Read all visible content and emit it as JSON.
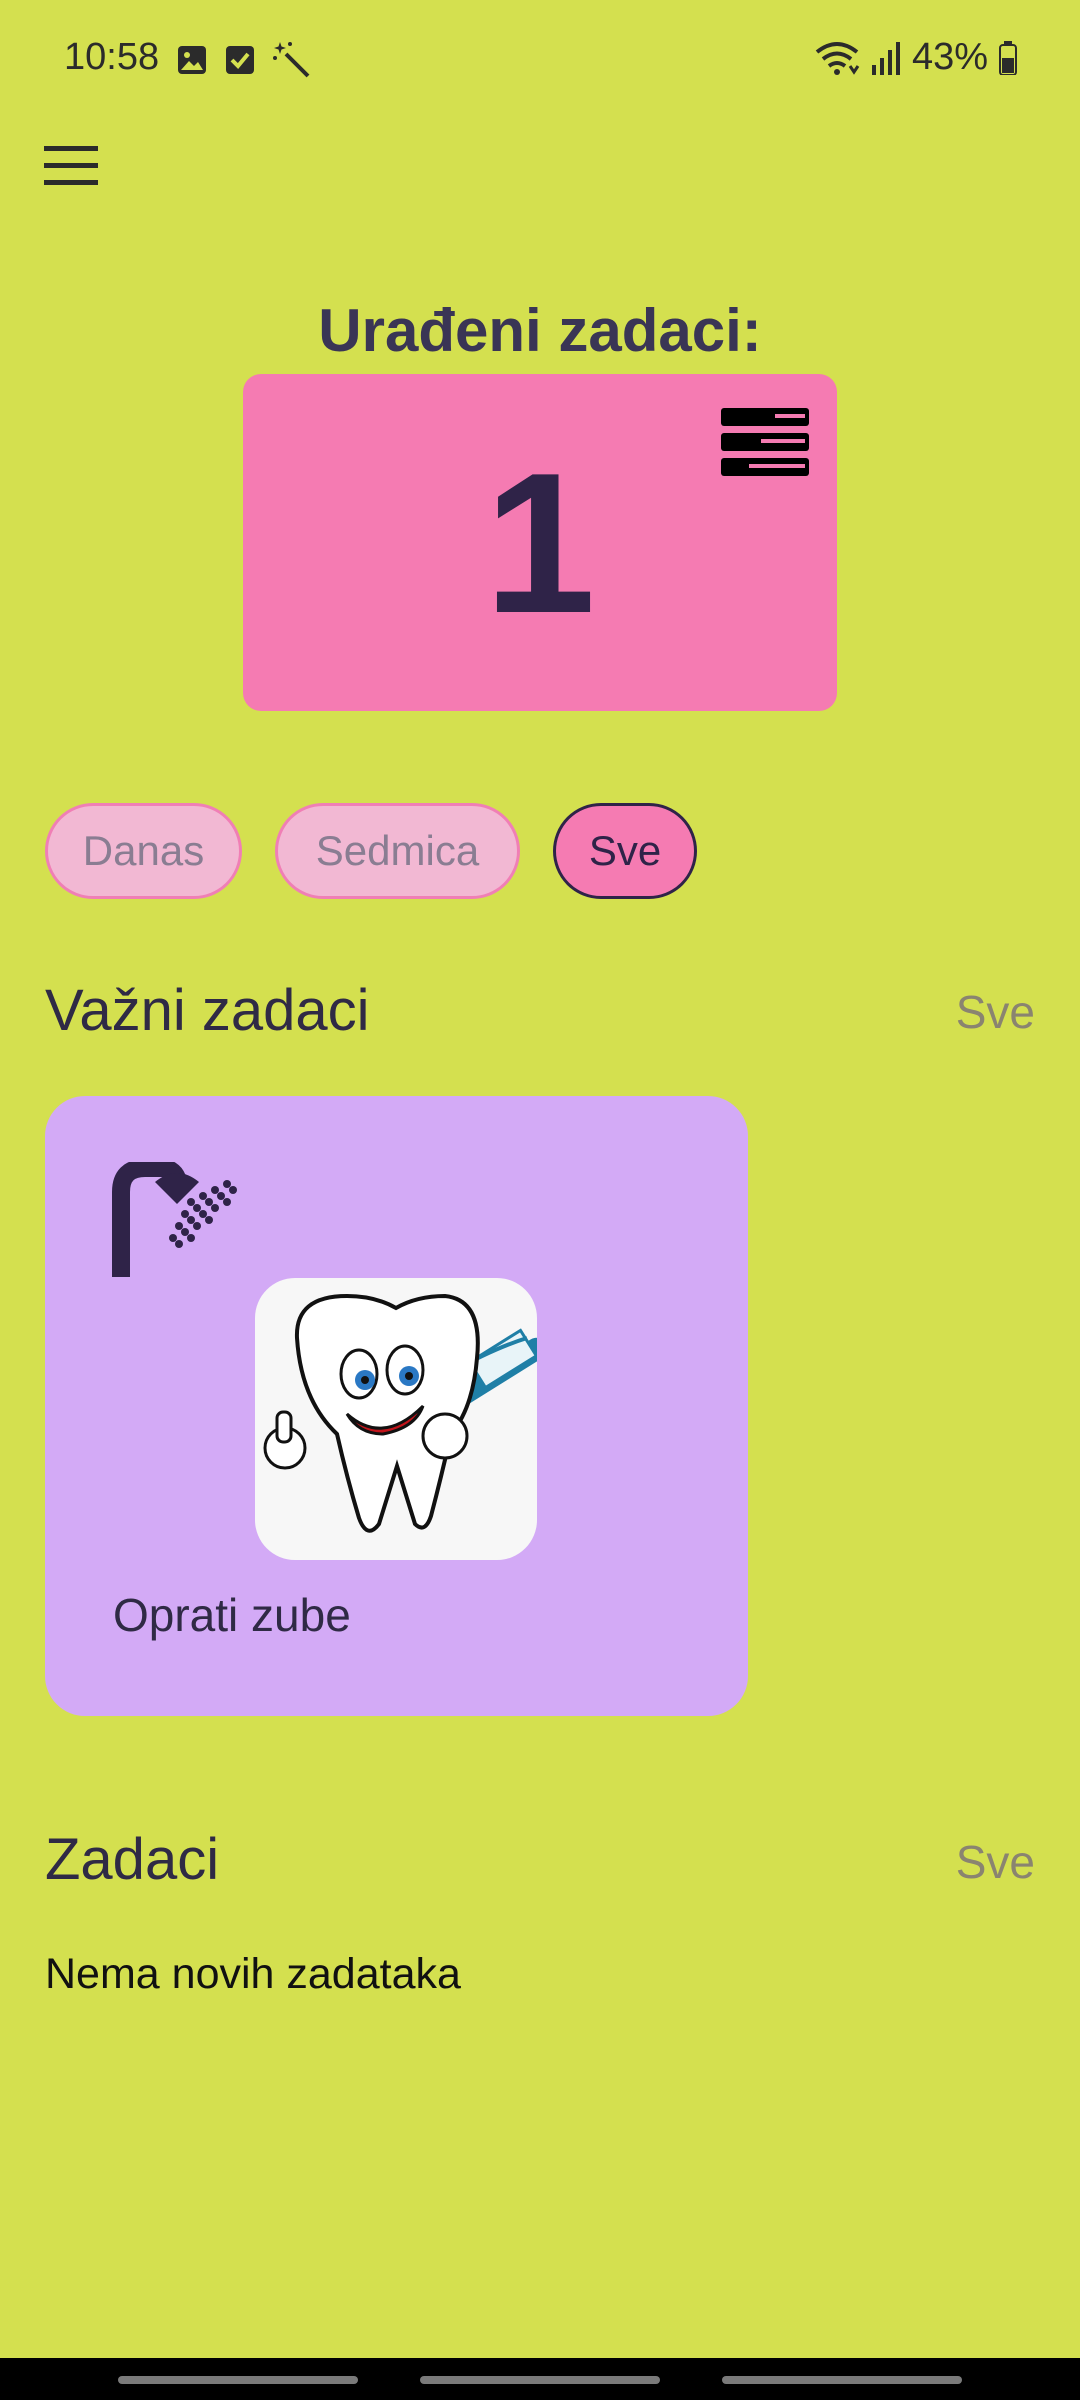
{
  "status_bar": {
    "time": "10:58",
    "battery": "43%",
    "left_icons": [
      "gallery-icon",
      "checkbox-icon",
      "magic-wand-icon"
    ],
    "right_icons": [
      "wifi-icon",
      "signal-icon",
      "battery-icon"
    ]
  },
  "header": {
    "menu_icon": "hamburger-menu-icon"
  },
  "done": {
    "title": "Urađeni zadaci:",
    "count": "1",
    "icon": "list-stack-icon"
  },
  "filters": [
    {
      "label": "Danas",
      "active": false
    },
    {
      "label": "Sedmica",
      "active": false
    },
    {
      "label": "Sve",
      "active": true
    }
  ],
  "important": {
    "title": "Važni zadaci",
    "see_all": "Sve",
    "tasks": [
      {
        "label": "Oprati zube",
        "category_icon": "shower-icon",
        "image": "tooth-brush-illustration"
      }
    ]
  },
  "tasks": {
    "title": "Zadaci",
    "see_all": "Sve",
    "empty_text": "Nema novih zadataka"
  },
  "colors": {
    "background": "#d4e04f",
    "accent_pink": "#f57bb2",
    "card_purple": "#d3aaf6",
    "text_dark": "#2f2348"
  }
}
